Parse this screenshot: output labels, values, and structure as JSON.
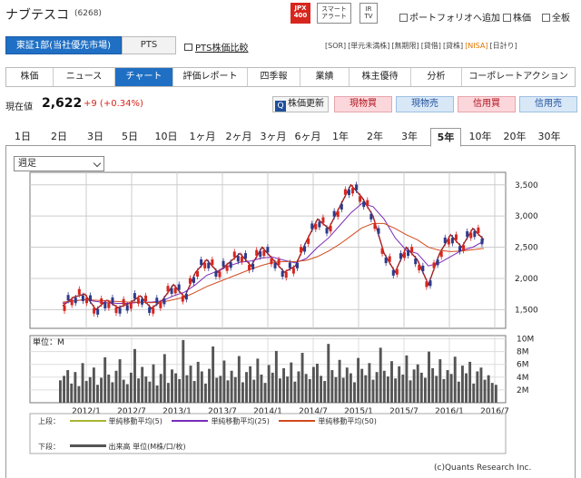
{
  "header": {
    "company_name": "ナブテスコ",
    "code": "(6268)",
    "icons": [
      {
        "name": "jpx400-badge",
        "label": "JPX\n400"
      },
      {
        "name": "smart-alert-badge",
        "label": "スマート\nアラート"
      },
      {
        "name": "ir-tv-badge",
        "label": "IR\nTV"
      }
    ],
    "links": {
      "portfolio": "ポートフォリオへ追加",
      "stock_price": "株価",
      "all": "全板"
    }
  },
  "market": {
    "selected": "東証1部(当社優先市場)",
    "pts": "PTS",
    "pts_compare": "PTS株価比較",
    "tags": [
      "[SOR]",
      "[単元未満株]",
      "[無期限]",
      "[貸借]",
      "[貸株]",
      "[NISA]",
      "[日計り]"
    ]
  },
  "tabs": [
    "株価",
    "ニュース",
    "チャート",
    "評価レポート",
    "四季報",
    "業績",
    "株主優待",
    "分析",
    "コーポレートアクション"
  ],
  "active_tab": "チャート",
  "price": {
    "label": "現在値",
    "value": "2,622",
    "change": "+9 (+0.34%)",
    "update_label": "株価更新",
    "buttons": [
      "現物買",
      "現物売",
      "信用買",
      "信用売"
    ]
  },
  "periods": [
    "1日",
    "2日",
    "3日",
    "5日",
    "10日",
    "1ヶ月",
    "2ヶ月",
    "3ヶ月",
    "6ヶ月",
    "1年",
    "2年",
    "3年",
    "5年",
    "10年",
    "20年",
    "30年"
  ],
  "active_period": "5年",
  "chart_select": "週足",
  "credit": "(c)Quants Research Inc.",
  "legend": {
    "upper_label": "上段：",
    "lower_label": "下段：",
    "ma5": "単純移動平均(5)",
    "ma25": "単純移動平均(25)",
    "ma50": "単純移動平均(50)",
    "volume": "出来高 単位(M株/口/枚)"
  },
  "colors": {
    "ma5": "#a7b531",
    "ma25": "#7a2bb8",
    "ma50": "#d24a1e",
    "up": "#d7261e",
    "down": "#2d3a8c",
    "accent": "#1f6fc4"
  },
  "chart_data": [
    {
      "type": "line",
      "title": "",
      "x_ticks": [
        "2012/1",
        "2012/7",
        "2013/1",
        "2013/7",
        "2014/1",
        "2014/7",
        "2015/1",
        "2015/7",
        "2016/1",
        "2016/7"
      ],
      "y_ticks": [
        "1,500",
        "2,000",
        "2,500",
        "3,000",
        "3,500"
      ],
      "ylim": [
        1200,
        3700
      ],
      "series": [
        {
          "name": "",
          "values": [
            1560,
            1700,
            1750,
            1500,
            1650,
            1530,
            1600,
            1720,
            1520,
            1650,
            1900,
            1700,
            2100,
            2300,
            2100,
            2250,
            2400,
            2200,
            2500,
            2300,
            2100,
            2200,
            2600,
            2950,
            2800,
            3150,
            3500,
            3300,
            3000,
            2400,
            2100,
            2500,
            2300,
            1900,
            2400,
            2700,
            2500,
            2800,
            2622
          ]
        },
        {
          "name": "単純移動平均(25)",
          "values": [
            1600,
            1640,
            1660,
            1630,
            1610,
            1600,
            1600,
            1620,
            1620,
            1640,
            1720,
            1780,
            1900,
            2050,
            2120,
            2200,
            2260,
            2280,
            2330,
            2340,
            2290,
            2250,
            2320,
            2500,
            2650,
            2850,
            3050,
            3200,
            3150,
            2950,
            2650,
            2450,
            2400,
            2200,
            2250,
            2350,
            2450,
            2500,
            2600
          ]
        },
        {
          "name": "単純移動平均(50)",
          "values": [
            1620,
            1640,
            1660,
            1650,
            1640,
            1630,
            1620,
            1620,
            1610,
            1620,
            1660,
            1700,
            1780,
            1870,
            1940,
            2010,
            2080,
            2150,
            2210,
            2260,
            2270,
            2270,
            2290,
            2350,
            2440,
            2550,
            2680,
            2810,
            2880,
            2880,
            2800,
            2700,
            2620,
            2500,
            2450,
            2430,
            2440,
            2460,
            2480
          ]
        }
      ]
    },
    {
      "type": "bar",
      "title": "",
      "unit_label": "単位：M",
      "y_ticks": [
        "2M",
        "4M",
        "6M",
        "8M",
        "10M"
      ],
      "ylim": [
        0,
        10.5
      ],
      "values": [
        3.5,
        4.2,
        5.1,
        3.0,
        4.8,
        2.6,
        6.2,
        3.4,
        4.0,
        5.5,
        2.8,
        3.9,
        7.1,
        4.4,
        3.2,
        5.0,
        6.8,
        3.6,
        2.9,
        4.7,
        8.4,
        3.8,
        5.6,
        4.1,
        3.3,
        6.0,
        2.7,
        4.5,
        7.6,
        3.1,
        5.2,
        4.6,
        3.7,
        9.8,
        4.3,
        5.8,
        3.4,
        6.4,
        4.9,
        3.0,
        5.3,
        8.8,
        3.9,
        4.2,
        6.6,
        3.5,
        5.0,
        4.0,
        7.3,
        3.2,
        4.8,
        5.7,
        3.6,
        6.9,
        4.4,
        3.1,
        5.9,
        4.7,
        8.1,
        3.8,
        5.4,
        4.1,
        6.3,
        3.3,
        4.9,
        7.8,
        4.5,
        3.7,
        5.6,
        6.1,
        4.2,
        3.4,
        9.2,
        5.1,
        4.0,
        6.7,
        3.9,
        5.5,
        4.6,
        3.2,
        7.0,
        5.3,
        4.3,
        6.2,
        3.6,
        4.8,
        8.6,
        5.0,
        4.1,
        6.5,
        3.8,
        5.7,
        4.4,
        7.4,
        3.5,
        5.2,
        6.0,
        4.7,
        3.9,
        8.0,
        5.4,
        4.2,
        6.8,
        3.7,
        5.1,
        4.5,
        7.2,
        3.3,
        5.8,
        4.6,
        6.4,
        3.0,
        4.9,
        5.5,
        3.6,
        4.3,
        3.1,
        2.8
      ]
    }
  ]
}
